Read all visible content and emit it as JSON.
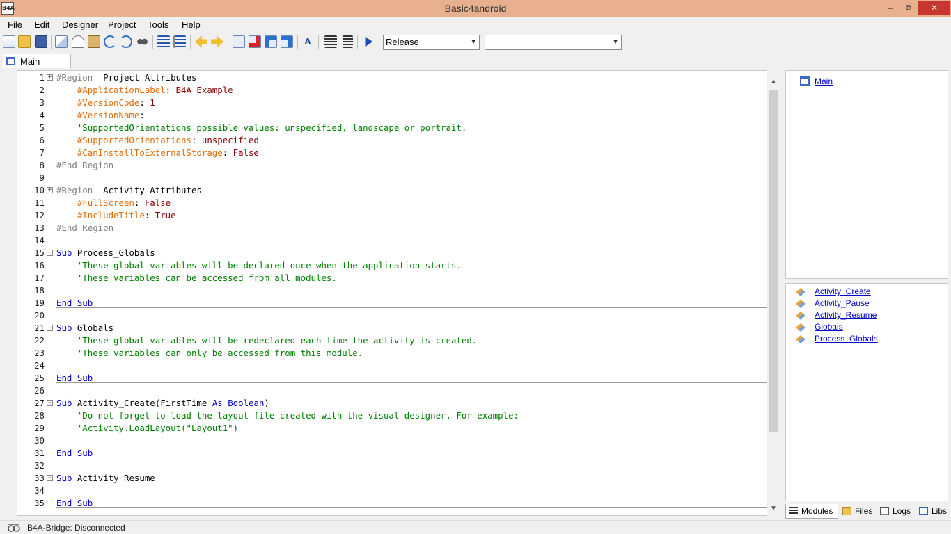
{
  "window": {
    "title": "Basic4android",
    "app_icon_text": "B4A",
    "minimize": "–",
    "maximize": "⧉",
    "close": "✕"
  },
  "menu": {
    "items": [
      {
        "label": "File"
      },
      {
        "label": "Edit"
      },
      {
        "label": "Designer"
      },
      {
        "label": "Project"
      },
      {
        "label": "Tools"
      },
      {
        "label": "Help"
      }
    ]
  },
  "toolbar": {
    "build_config": "Release",
    "build_config_arrow": "▼",
    "second_combo": "",
    "second_combo_arrow": "▼",
    "icons": [
      "new-file-icon",
      "open-folder-icon",
      "save-icon",
      "copy-icon",
      "cut-icon",
      "paste-icon",
      "undo-icon",
      "redo-icon",
      "find-icon",
      "comment-icon",
      "uncomment-icon",
      "back-arrow-icon",
      "forward-arrow-icon",
      "bookmark-icon",
      "clear-bookmarks-icon",
      "previous-bookmark-icon",
      "next-bookmark-icon",
      "font-size-icon",
      "outdent-icon",
      "indent-icon",
      "run-icon"
    ]
  },
  "doc_tab": {
    "label": "Main"
  },
  "editor": {
    "lines": [
      {
        "n": "1",
        "fold": "+"
      },
      {
        "n": "2"
      },
      {
        "n": "3"
      },
      {
        "n": "4"
      },
      {
        "n": "5"
      },
      {
        "n": "6"
      },
      {
        "n": "7"
      },
      {
        "n": "8"
      },
      {
        "n": "9"
      },
      {
        "n": "10",
        "fold": "+"
      },
      {
        "n": "11"
      },
      {
        "n": "12"
      },
      {
        "n": "13"
      },
      {
        "n": "14"
      },
      {
        "n": "15",
        "fold": "-"
      },
      {
        "n": "16"
      },
      {
        "n": "17"
      },
      {
        "n": "18"
      },
      {
        "n": "19"
      },
      {
        "n": "20"
      },
      {
        "n": "21",
        "fold": "-"
      },
      {
        "n": "22"
      },
      {
        "n": "23"
      },
      {
        "n": "24"
      },
      {
        "n": "25"
      },
      {
        "n": "26"
      },
      {
        "n": "27",
        "fold": "-"
      },
      {
        "n": "28"
      },
      {
        "n": "29"
      },
      {
        "n": "30"
      },
      {
        "n": "31"
      },
      {
        "n": "32"
      },
      {
        "n": "33",
        "fold": "-"
      },
      {
        "n": "34"
      },
      {
        "n": "35"
      }
    ],
    "tokens": {
      "l1_dir": "#Region",
      "l1_txt": "  Project Attributes",
      "l2_attr": "    #ApplicationLabel",
      "l2_sep": ": ",
      "l2_val": "B4A Example",
      "l3_attr": "    #VersionCode",
      "l3_sep": ": ",
      "l3_val": "1",
      "l4_attr": "    #VersionName",
      "l4_sep": ":",
      "l5_cmt": "    'SupportedOrientations possible values: unspecified, landscape or portrait.",
      "l6_attr": "    #SupportedOrientations",
      "l6_sep": ": ",
      "l6_val": "unspecified",
      "l7_attr": "    #CanInstallToExternalStorage",
      "l7_sep": ": ",
      "l7_val": "False",
      "l8_dir": "#End Region",
      "l10_dir": "#Region",
      "l10_txt": "  Activity Attributes",
      "l11_attr": "    #FullScreen",
      "l11_sep": ": ",
      "l11_val": "False",
      "l12_attr": "    #IncludeTitle",
      "l12_sep": ": ",
      "l12_val": "True",
      "l13_dir": "#End Region",
      "l15_kw": "Sub",
      "l15_txt": " Process_Globals",
      "l16_cmt": "    'These global variables will be declared once when the application starts.",
      "l17_cmt": "    'These variables can be accessed from all modules.",
      "l19_kw": "End Sub",
      "l21_kw": "Sub",
      "l21_txt": " Globals",
      "l22_cmt": "    'These global variables will be redeclared each time the activity is created.",
      "l23_cmt": "    'These variables can only be accessed from this module.",
      "l25_kw": "End Sub",
      "l27_kw": "Sub",
      "l27_txt": " Activity_Create(FirstTime ",
      "l27_kw2": "As",
      "l27_sp": " ",
      "l27_type": "Boolean",
      "l27_close": ")",
      "l28_cmt": "    'Do not forget to load the layout file created with the visual designer. For example:",
      "l29_cmt": "    'Activity.LoadLayout(\"Layout1\")",
      "l31_kw": "End Sub",
      "l33_kw": "Sub",
      "l33_txt": " Activity_Resume",
      "l35_kw": "End Sub"
    },
    "scroll_up": "▲",
    "scroll_down": "▼"
  },
  "right_panel": {
    "module": "Main",
    "subs": [
      "Activity_Create",
      "Activity_Pause",
      "Activity_Resume",
      "Globals",
      "Process_Globals"
    ],
    "tabs": {
      "modules": "Modules",
      "files": "Files",
      "logs": "Logs",
      "libs": "Libs"
    }
  },
  "status": {
    "text": "B4A-Bridge: Disconnected"
  },
  "colors": {
    "titlebar": "#e8b08f",
    "keyword": "#0000c8",
    "attribute": "#e36c0a",
    "comment": "#008000",
    "value": "#8b0000"
  }
}
